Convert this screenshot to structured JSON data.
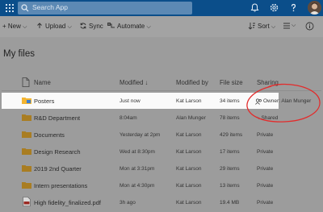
{
  "header": {
    "search_placeholder": "Search App",
    "icons": [
      "app-launcher-icon",
      "search-icon",
      "bell-icon",
      "settings-icon",
      "help-icon"
    ],
    "accent": "#0b4e8a"
  },
  "commands": {
    "new": "New",
    "upload": "Upload",
    "sync": "Sync",
    "automate": "Automate",
    "sort": "Sort"
  },
  "page": {
    "title": "My files"
  },
  "table": {
    "headers": {
      "name": "Name",
      "modified": "Modified",
      "sort_arrow": "↓",
      "modified_by": "Modified by",
      "file_size": "File size",
      "sharing": "Sharing"
    },
    "rows": [
      {
        "name": "Posters",
        "modified": "Just now",
        "modified_by": "Kat Larson",
        "size": "34 items",
        "sharing": "Owner: Alan Munger"
      },
      {
        "name": "R&D Department",
        "modified": "8:04am",
        "modified_by": "Alan Munger",
        "size": "78 items",
        "sharing": "Shared"
      },
      {
        "name": "Documents",
        "modified": "Yesterday at 2pm",
        "modified_by": "Kat Larson",
        "size": "429 items",
        "sharing": "Private"
      },
      {
        "name": "Design Research",
        "modified": "Wed at 8:30pm",
        "modified_by": "Kat Larson",
        "size": "17 items",
        "sharing": "Private"
      },
      {
        "name": "2019 2nd Quarter",
        "modified": "Mon at 3:31pm",
        "modified_by": "Kat Larson",
        "size": "29 items",
        "sharing": "Private"
      },
      {
        "name": "Intern presentations",
        "modified": "Mon at 4:30pm",
        "modified_by": "Kat Larson",
        "size": "13 items",
        "sharing": "Private"
      },
      {
        "name": "High fidelity_finalized.pdf",
        "modified": "3h ago",
        "modified_by": "Kat Larson",
        "size": "19.4 MB",
        "sharing": "Private"
      }
    ]
  },
  "colors": {
    "folder": "#f4b532",
    "selected_row": "#fafafa",
    "annotation": "#e32b2b"
  }
}
